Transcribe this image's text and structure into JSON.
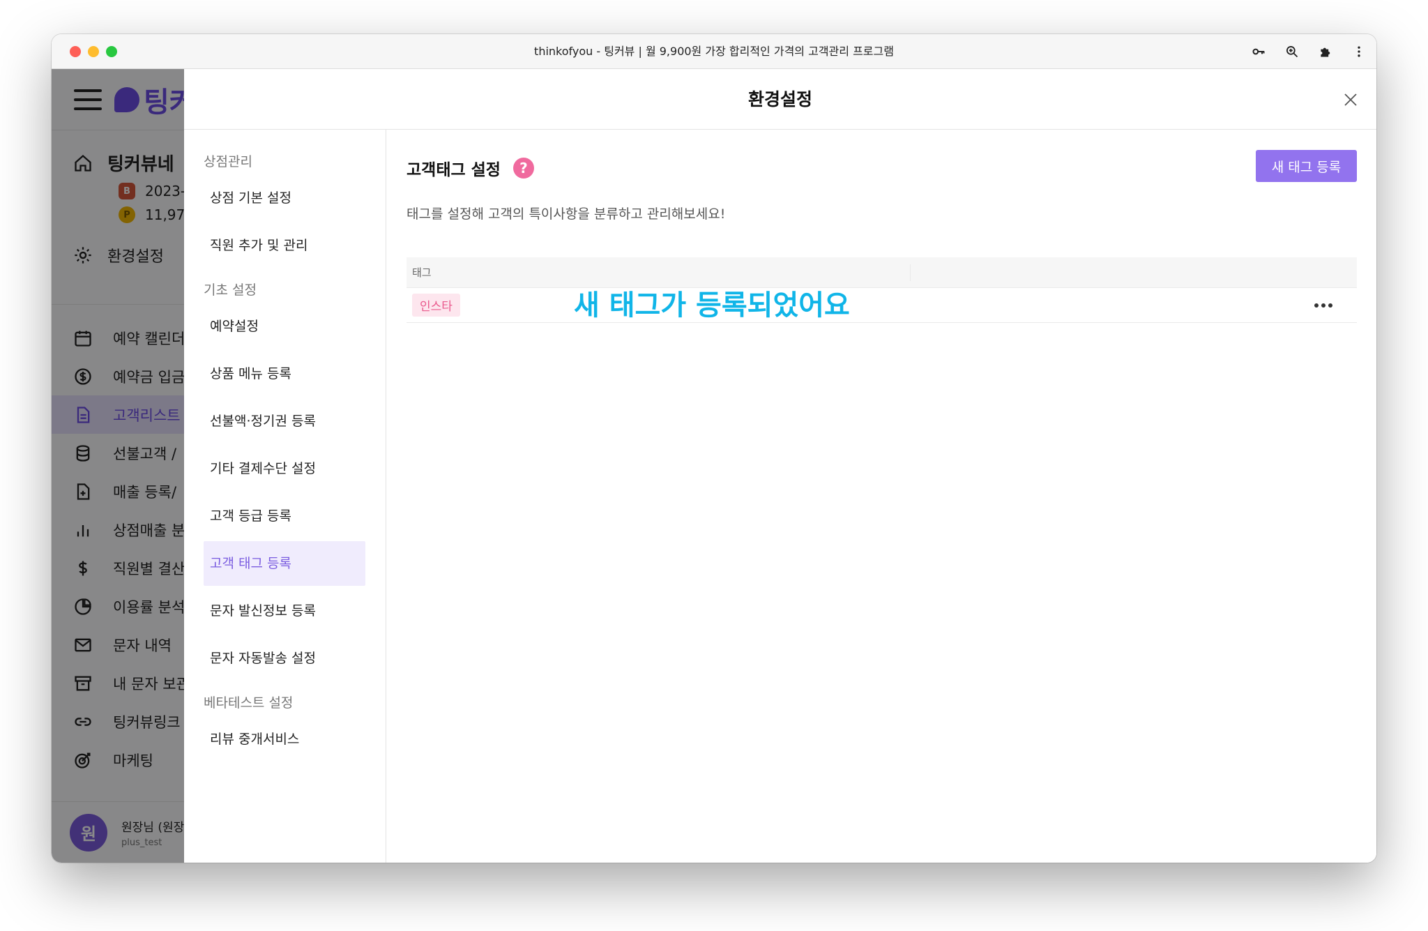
{
  "window": {
    "title": "thinkofyou - 팅커뷰 | 월 9,900원 가장 합리적인 가격의 고객관리 프로그램",
    "toolbar_icons": [
      "key-icon",
      "zoom-icon",
      "extension-icon",
      "more-vert-icon"
    ]
  },
  "app": {
    "brand": "팅커",
    "store": {
      "name": "팅커뷰네",
      "date": "2023-",
      "points": "11,97",
      "settings_label": "환경설정"
    },
    "nav": [
      {
        "label": "예약 캘린더",
        "icon": "calendar-icon"
      },
      {
        "label": "예약금 입금",
        "icon": "dollar-circle-icon"
      },
      {
        "label": "고객리스트",
        "icon": "document-icon",
        "active": true
      },
      {
        "label": "선불고객 / ",
        "icon": "database-icon"
      },
      {
        "label": "매출 등록/",
        "icon": "file-plus-icon"
      },
      {
        "label": "상점매출 분",
        "icon": "bar-chart-icon"
      },
      {
        "label": "직원별 결산",
        "icon": "dollar-icon"
      },
      {
        "label": "이용률 분석",
        "icon": "pie-chart-icon"
      },
      {
        "label": "문자 내역",
        "icon": "mail-icon"
      },
      {
        "label": "내 문자 보관",
        "icon": "archive-icon"
      },
      {
        "label": "팅커뷰링크",
        "icon": "link-icon"
      },
      {
        "label": "마케팅",
        "icon": "target-icon"
      }
    ],
    "user": {
      "avatar": "원",
      "name": "원장님 (원장",
      "sub": "plus_test"
    }
  },
  "modal": {
    "title": "환경설정",
    "sections": [
      {
        "label": "상점관리",
        "items": [
          "상점 기본 설정",
          "직원 추가 및 관리"
        ]
      },
      {
        "label": "기초 설정",
        "items": [
          "예약설정",
          "상품 메뉴 등록",
          "선불액·정기권 등록",
          "기타 결제수단 설정",
          "고객 등급 등록",
          "고객 태그 등록",
          "문자 발신정보 등록",
          "문자 자동발송 설정"
        ]
      },
      {
        "label": "베타테스트 설정",
        "items": [
          "리뷰 중개서비스"
        ]
      }
    ],
    "active_item": "고객 태그 등록",
    "content": {
      "title": "고객태그 설정",
      "help": "?",
      "new_button": "새 태그 등록",
      "description": "태그를 설정해 고객의 특이사항을 분류하고 관리해보세요!",
      "table_header": "태그",
      "tags": [
        "인스타"
      ],
      "toast": "새 태그가 등록되었어요"
    }
  },
  "colors": {
    "accent": "#9273ee",
    "brand": "#6c4ce6",
    "tag_bg": "#fde6ee",
    "tag_text": "#ea5a8d",
    "toast": "#10b5e8"
  }
}
